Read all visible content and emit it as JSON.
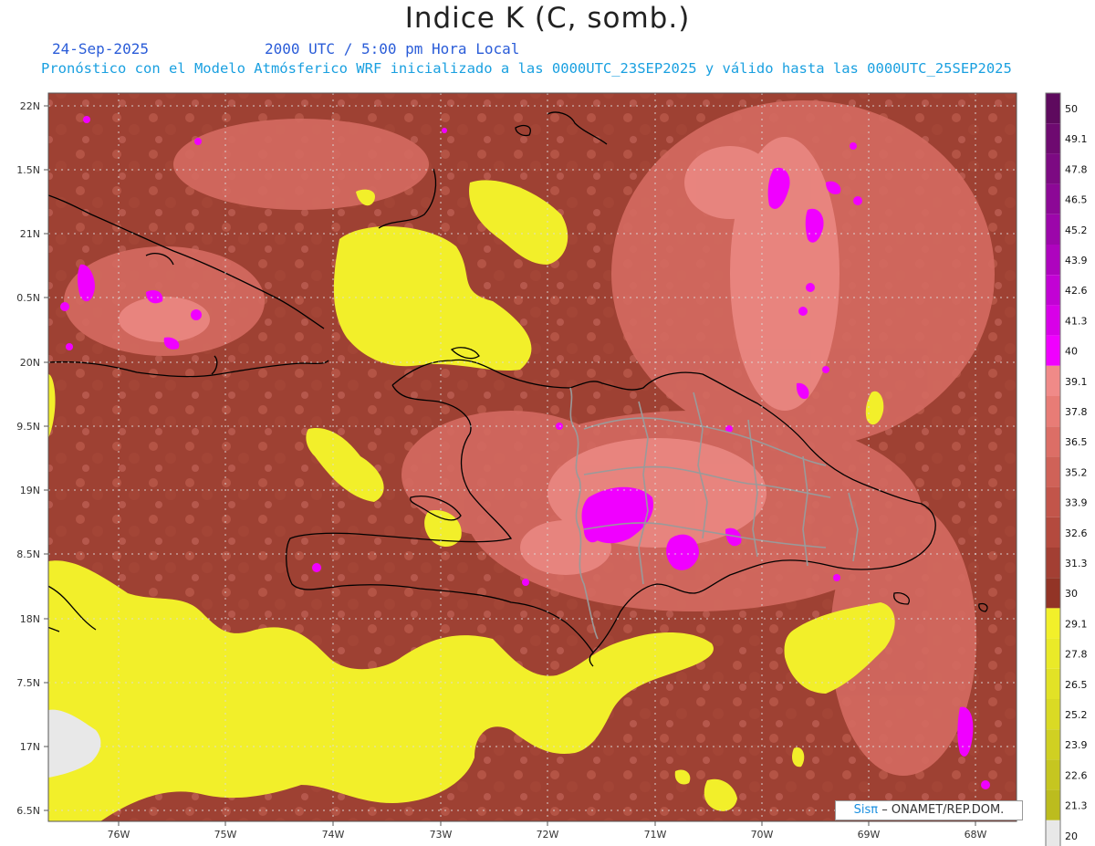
{
  "header": {
    "title": "Indice K (C, somb.)",
    "date": "24-Sep-2025",
    "time": "2000 UTC / 5:00 pm Hora Local",
    "forecast": "Pronóstico con el Modelo Atmósferico WRF inicializado a las 0000UTC_23SEP2025 y válido hasta las  0000UTC_25SEP2025"
  },
  "axes": {
    "lat_labels": [
      "22N",
      "1.5N",
      "21N",
      "0.5N",
      "20N",
      "9.5N",
      "19N",
      "8.5N",
      "18N",
      "7.5N",
      "17N",
      "6.5N"
    ],
    "lon_labels": [
      "76W",
      "75W",
      "74W",
      "73W",
      "72W",
      "71W",
      "70W",
      "69W",
      "68W"
    ]
  },
  "colorbar": {
    "levels": [
      "50",
      "49.1",
      "47.8",
      "46.5",
      "45.2",
      "43.9",
      "42.6",
      "41.3",
      "40",
      "39.1",
      "37.8",
      "36.5",
      "35.2",
      "33.9",
      "32.6",
      "31.3",
      "30",
      "29.1",
      "27.8",
      "26.5",
      "25.2",
      "23.9",
      "22.6",
      "21.3",
      "20"
    ],
    "colors": [
      "#5e0a5e",
      "#6e0a70",
      "#7c0a82",
      "#8c0896",
      "#9c06aa",
      "#ae04be",
      "#c202d4",
      "#d800e8",
      "#f000ff",
      "#f08a88",
      "#e87c76",
      "#dc6e66",
      "#cf6258",
      "#c2554a",
      "#b44a3e",
      "#a33f33",
      "#923426",
      "#f2f02a",
      "#eaea28",
      "#e2e226",
      "#dada24",
      "#d0d022",
      "#c6c620",
      "#bcbc1e",
      "#e8e8e8"
    ]
  },
  "credit": {
    "brand": "Sisπ",
    "text": "– ONAMET/REP.DOM."
  }
}
